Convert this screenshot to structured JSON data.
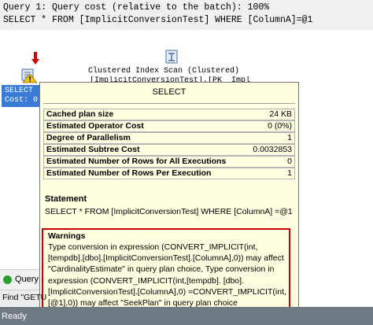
{
  "query_header": {
    "line1": "Query 1: Query cost (relative to the batch): 100%",
    "line2": "SELECT * FROM [ImplicitConversionTest] WHERE [ColumnA]=@1"
  },
  "plan": {
    "scan_node_label": "Clustered Index Scan (Clustered)",
    "scan_node_sublabel": "[ImplicitConversionTest].[PK__Impli",
    "select_node_label": "SELECT",
    "select_node_cost": "Cost: 0"
  },
  "tooltip": {
    "title": "SELECT",
    "properties": [
      {
        "key": "Cached plan size",
        "value": "24 KB"
      },
      {
        "key": "Estimated Operator Cost",
        "value": "0 (0%)"
      },
      {
        "key": "Degree of Parallelism",
        "value": "1"
      },
      {
        "key": "Estimated Subtree Cost",
        "value": "0.0032853"
      },
      {
        "key": "Estimated Number of Rows for All Executions",
        "value": "0"
      },
      {
        "key": "Estimated Number of Rows Per Execution",
        "value": "1"
      }
    ],
    "statement_label": "Statement",
    "statement_text": "SELECT * FROM [ImplicitConversionTest] WHERE [ColumnA] =@1",
    "warnings_label": "Warnings",
    "warnings_text": "Type conversion in expression (CONVERT_IMPLICIT(int, [tempdb].[dbo].[ImplicitConversionTest].[ColumnA],0)) may affect \"CardinalityEstimate\" in query plan choice, Type conversion in expression (CONVERT_IMPLICIT(int,[tempdb]. [dbo].[ImplicitConversionTest].[ColumnA],0) =CONVERT_IMPLICIT(int,[@1],0)) may affect \"SeekPlan\" in query plan choice"
  },
  "bottom": {
    "messages_tab": "Query",
    "find_text": "Find \"GETU",
    "status": "Ready"
  },
  "colors": {
    "tooltip_bg": "#ffffe1",
    "warning_border": "#d00000",
    "selected_node": "#3a7bd5",
    "status_bar": "#707a84"
  }
}
